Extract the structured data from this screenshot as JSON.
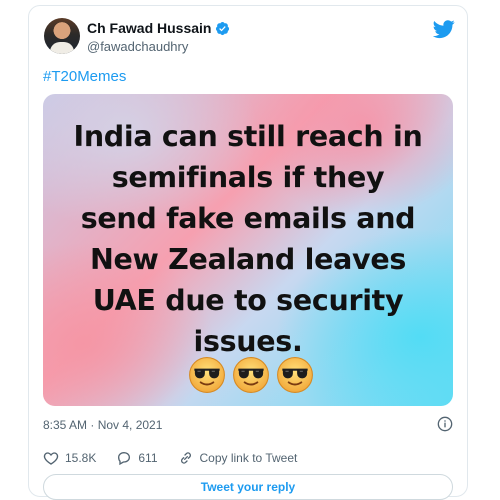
{
  "author": {
    "name": "Ch Fawad Hussain",
    "handle": "@fawadchaudhry"
  },
  "tweet": {
    "hashtag": "#T20Memes",
    "meme_lines": [
      "India can still reach in",
      "semifinals if they",
      "send fake emails and",
      "New Zealand leaves",
      "UAE due to security",
      "issues."
    ],
    "emoji_count": 3,
    "timestamp": "8:35 AM · Nov 4, 2021"
  },
  "actions": {
    "likes": "15.8K",
    "replies": "611",
    "copy_link": "Copy link to Tweet"
  },
  "reply_button": "Tweet your reply",
  "colors": {
    "accent": "#1d9bf0",
    "heart": "#536471",
    "border": "#e1e8ed"
  },
  "icons": [
    "verified-badge-icon",
    "twitter-bird-icon",
    "info-icon",
    "heart-icon",
    "reply-icon",
    "link-icon",
    "sunglasses-emoji-icon"
  ]
}
